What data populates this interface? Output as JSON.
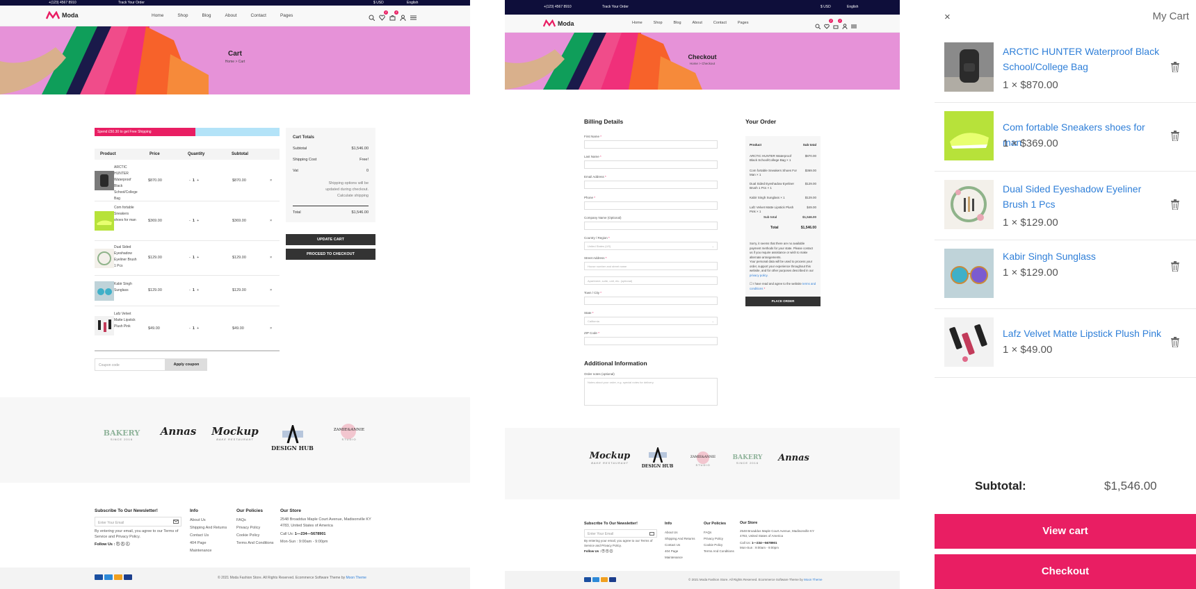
{
  "colors": {
    "accent": "#e91e63",
    "topbar": "#0e0e3a",
    "hero": "#e692d8",
    "link": "#2f7fd8",
    "shipbar": "#b3e3f8"
  },
  "topbar": {
    "phone": "+(123) 4567 8910",
    "track": "Track Your Order",
    "currency": "$ USD",
    "language": "English"
  },
  "brand": {
    "name": "Moda"
  },
  "nav": [
    "Home",
    "Shop",
    "Blog",
    "About",
    "Contact",
    "Pages"
  ],
  "header_icons": {
    "wishlist_count": "2",
    "cart_count": "2"
  },
  "cart_page": {
    "title": "Cart",
    "breadcrumb_home": "Home",
    "breadcrumb_sep": ">",
    "breadcrumb_current": "Cart",
    "shipping_notice": "Spend £50.30 to get Free Shipping",
    "columns": [
      "Product",
      "Price",
      "Quantity",
      "Subtotal"
    ],
    "rows": [
      {
        "name": "ARCTIC HUNTER Waterproof Black School/College Bag",
        "price": "$870.00",
        "qty": "1",
        "subtotal": "$870.00"
      },
      {
        "name": "Com fortable Sneakers shoes for man",
        "price": "$369.00",
        "qty": "1",
        "subtotal": "$369.00"
      },
      {
        "name": "Dual Sided Eyeshadow Eyeliner Brush 1 Pcs",
        "price": "$129.00",
        "qty": "1",
        "subtotal": "$129.00"
      },
      {
        "name": "Kabir Singh Sunglass",
        "price": "$129.00",
        "qty": "1",
        "subtotal": "$129.00"
      },
      {
        "name": "Lafz Velvet Matte Lipstick Plush Pink",
        "price": "$49.00",
        "qty": "1",
        "subtotal": "$49.00"
      }
    ],
    "qty_minus": "-",
    "qty_plus": "+",
    "remove_glyph": "×",
    "coupon_placeholder": "Coupon code",
    "apply_coupon": "Apply coupon",
    "totals": {
      "title": "Cart Totals",
      "subtotal_label": "Subtotal",
      "subtotal": "$1,546.00",
      "shipping_label": "Shipping Cost",
      "shipping": "Free!",
      "vat_label": "Vat",
      "vat": "0",
      "shipping_note": "Shipping options will be updated during checkout. Calculate shipping",
      "total_label": "Total",
      "total": "$1,546.00"
    },
    "update_cart": "UPDATE CART",
    "proceed": "PROCEED TO CHECKOUT"
  },
  "checkout_page": {
    "title": "Checkout",
    "breadcrumb_home": "Home",
    "breadcrumb_sep": ">",
    "breadcrumb_current": "Checkout",
    "billing_title": "Billing Details",
    "fields": [
      {
        "label": "First Name",
        "req": true,
        "ph": ""
      },
      {
        "label": "Last Name",
        "req": true,
        "ph": ""
      },
      {
        "label": "Email Address",
        "req": true,
        "ph": ""
      },
      {
        "label": "Phone",
        "req": true,
        "ph": ""
      },
      {
        "label": "Company Name (Optional)",
        "req": false,
        "ph": ""
      },
      {
        "label": "Country / Region",
        "req": true,
        "ph": "United States (US)"
      },
      {
        "label": "Street Address",
        "req": true,
        "ph": "House number and street name"
      },
      {
        "label": "",
        "req": false,
        "ph": "Apartment, suite, unit, etc. (optional)"
      },
      {
        "label": "Town / City",
        "req": true,
        "ph": ""
      },
      {
        "label": "State",
        "req": true,
        "ph": "California"
      },
      {
        "label": "ZIP Code",
        "req": true,
        "ph": ""
      }
    ],
    "req_mark": "*",
    "additional_title": "Additional Information",
    "notes_label": "Order notes (optional)",
    "notes_ph": "Notes about your order, e.g. special notes for delivery.",
    "order_title": "Your Order",
    "order_head_product": "Product",
    "order_head_subtotal": "Sub total",
    "order_rows": [
      {
        "name": "ARCTIC HUNTER Waterproof Black School/College Bag × 1",
        "price": "$870.00"
      },
      {
        "name": "Com fortable Sneakers Shoes For Man × 1",
        "price": "$369.00"
      },
      {
        "name": "Dual Sided Eyeshadow Eyeliner Brush 1 Pcs × 1",
        "price": "$129.00"
      },
      {
        "name": "Kabir Singh Sunglass × 1",
        "price": "$129.00"
      },
      {
        "name": "Lafz Velvet Matte Lipstick Plush Pink × 1",
        "price": "$49.00"
      }
    ],
    "order_subtotal_label": "Sub total",
    "order_subtotal": "$1,546.00",
    "order_total_label": "Total",
    "order_total": "$1,546.00",
    "payment_note": "Sorry, it seems that there are no available payment methods for your state. Please contact us if you require assistance or wish to make alternate arrangements.",
    "privacy_note": "Your personal data will be used to process your order, support your experience throughout this website, and for other purposes described in our",
    "privacy_link": "privacy policy.",
    "terms_text": "I have read and agree to the website",
    "terms_link": "terms and conditions",
    "place_order": "PLACE ORDER"
  },
  "brands": [
    "BAKERY",
    "Annas",
    "Mockup",
    "DESIGN HUB",
    "ZAMIE&ANNIE"
  ],
  "brand_sub": [
    "SINCE 2016",
    "",
    "BAKE RESTAURANT",
    "",
    "STUDIO"
  ],
  "footer": {
    "newsletter_title": "Subscribe To Our Newsletter!",
    "email_ph": "Enter Your Email",
    "newsletter_note": "By entering your email, you agree to our Terms of Service and Privacy Policy.",
    "follow": "Follow Us :",
    "info_title": "Info",
    "info_links": [
      "About Us",
      "Shipping And Returns",
      "Contact Us",
      "404 Page",
      "Maintenance"
    ],
    "policies_title": "Our Policies",
    "policies_links": [
      "FAQs",
      "Privacy Policy",
      "Cookie Policy",
      "Terms And Conditions"
    ],
    "store_title": "Our Store",
    "address": "2548 Broaddus Maple Court Avenue, Madisonville KY 4783, United States of America",
    "call_label": "Call Us:",
    "call": "1—234—5678901",
    "hours": "Mon-Sun : 9:00am - 9:00pm",
    "copyright": "© 2021 Moda Fashion Store. All Rights Reserved. Ecommerce Software Theme by",
    "copyright_link": "Moon Theme",
    "payments": [
      "VISA",
      "AMEX",
      "MC",
      "PayPal"
    ]
  },
  "mini_cart": {
    "title": "My Cart",
    "close": "×",
    "items": [
      {
        "name": "ARCTIC HUNTER Waterproof Black School/College Bag",
        "price": "1 × $870.00"
      },
      {
        "name": "Com fortable Sneakers shoes for man",
        "price": "1 × $369.00"
      },
      {
        "name": "Dual Sided Eyeshadow Eyeliner Brush 1 Pcs",
        "price": "1 × $129.00"
      },
      {
        "name": "Kabir Singh Sunglass",
        "price": "1 × $129.00"
      },
      {
        "name": "Lafz Velvet Matte Lipstick Plush Pink",
        "price": "1 × $49.00"
      }
    ],
    "subtotal_label": "Subtotal:",
    "subtotal": "$1,546.00",
    "view_cart": "View cart",
    "checkout": "Checkout"
  }
}
